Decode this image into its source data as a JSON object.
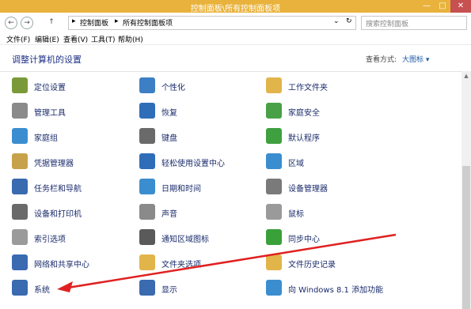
{
  "window": {
    "title": "控制面板\\所有控制面板项",
    "minimize": "—",
    "maximize": "□",
    "close": "✕"
  },
  "address": {
    "back": "←",
    "forward": "→",
    "up": "↑",
    "sep1": "▸",
    "crumb1": "控制面板",
    "sep2": "▸",
    "crumb2": "所有控制面板项",
    "dropdown": "⌄",
    "refresh": "↻"
  },
  "search": {
    "placeholder": "搜索控制面板"
  },
  "menu": [
    "文件(F)",
    "编辑(E)",
    "查看(V)",
    "工具(T)",
    "帮助(H)"
  ],
  "page": {
    "heading": "调整计算机的设置",
    "view_by_label": "查看方式:",
    "view_by_value": "大图标 ▾"
  },
  "items": [
    {
      "label": "定位设置",
      "icon": "location-settings-icon",
      "color": "#7a9a3a"
    },
    {
      "label": "个性化",
      "icon": "personalization-icon",
      "color": "#3d7fc4"
    },
    {
      "label": "工作文件夹",
      "icon": "work-folders-icon",
      "color": "#e2b54a"
    },
    {
      "label": "管理工具",
      "icon": "admin-tools-icon",
      "color": "#8a8a8a"
    },
    {
      "label": "恢复",
      "icon": "recovery-icon",
      "color": "#2f6db8"
    },
    {
      "label": "家庭安全",
      "icon": "family-safety-icon",
      "color": "#4aa046"
    },
    {
      "label": "家庭组",
      "icon": "homegroup-icon",
      "color": "#3a8ed0"
    },
    {
      "label": "键盘",
      "icon": "keyboard-icon",
      "color": "#6a6a6a"
    },
    {
      "label": "默认程序",
      "icon": "default-programs-icon",
      "color": "#3fa03f"
    },
    {
      "label": "凭据管理器",
      "icon": "credential-manager-icon",
      "color": "#c8a24a"
    },
    {
      "label": "轻松使用设置中心",
      "icon": "ease-of-access-icon",
      "color": "#2f6db8"
    },
    {
      "label": "区域",
      "icon": "region-icon",
      "color": "#3a8ed0"
    },
    {
      "label": "任务栏和导航",
      "icon": "taskbar-icon",
      "color": "#3a6ab0"
    },
    {
      "label": "日期和时间",
      "icon": "date-time-icon",
      "color": "#3a8ed0"
    },
    {
      "label": "设备管理器",
      "icon": "device-manager-icon",
      "color": "#7a7a7a"
    },
    {
      "label": "设备和打印机",
      "icon": "devices-printers-icon",
      "color": "#6a6a6a"
    },
    {
      "label": "声音",
      "icon": "sound-icon",
      "color": "#8a8a8a"
    },
    {
      "label": "鼠标",
      "icon": "mouse-icon",
      "color": "#9a9a9a"
    },
    {
      "label": "索引选项",
      "icon": "indexing-options-icon",
      "color": "#9a9a9a"
    },
    {
      "label": "通知区域图标",
      "icon": "notification-icons-icon",
      "color": "#5a5a5a"
    },
    {
      "label": "同步中心",
      "icon": "sync-center-icon",
      "color": "#3aa03a"
    },
    {
      "label": "网络和共享中心",
      "icon": "network-sharing-icon",
      "color": "#3a6ab0"
    },
    {
      "label": "文件夹选项",
      "icon": "folder-options-icon",
      "color": "#e2b54a"
    },
    {
      "label": "文件历史记录",
      "icon": "file-history-icon",
      "color": "#e2b54a"
    },
    {
      "label": "系统",
      "icon": "system-icon",
      "color": "#3a6ab0"
    },
    {
      "label": "显示",
      "icon": "display-icon",
      "color": "#3a6ab0"
    },
    {
      "label": "向 Windows 8.1 添加功能",
      "icon": "add-features-icon",
      "color": "#3a8ed0"
    }
  ],
  "annotation": {
    "arrow_color": "#e02020"
  }
}
